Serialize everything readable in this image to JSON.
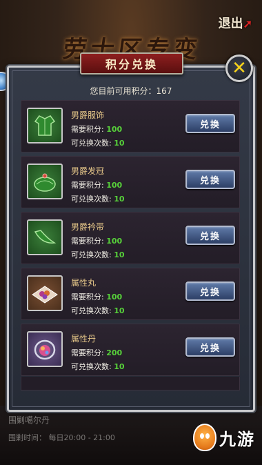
{
  "background": {
    "title": "劳士区专变",
    "exit_label": "退出",
    "bottom_event_name": "围剿噶尔丹",
    "bottom_event_time": "围剿时间：  每日20:00 - 21:00"
  },
  "watermark": {
    "text": "九游"
  },
  "dialog": {
    "title": "积分兑换",
    "points_label": "您目前可用积分：",
    "points_value": "167"
  },
  "items": [
    {
      "name": "男爵服饰",
      "required_label": "需要积分:",
      "required": "100",
      "count_label": "可兑换次数:",
      "count": "10",
      "button": "兑换",
      "icon": "robe-icon"
    },
    {
      "name": "男爵发冠",
      "required_label": "需要积分:",
      "required": "100",
      "count_label": "可兑换次数:",
      "count": "10",
      "button": "兑换",
      "icon": "hat-icon"
    },
    {
      "name": "男爵衿带",
      "required_label": "需要积分:",
      "required": "100",
      "count_label": "可兑换次数:",
      "count": "10",
      "button": "兑换",
      "icon": "sash-icon"
    },
    {
      "name": "属性丸",
      "required_label": "需要积分:",
      "required": "100",
      "count_label": "可兑换次数:",
      "count": "10",
      "button": "兑换",
      "icon": "pills-icon"
    },
    {
      "name": "属性丹",
      "required_label": "需要积分:",
      "required": "200",
      "count_label": "可兑换次数:",
      "count": "10",
      "button": "兑换",
      "icon": "elixir-icon"
    }
  ],
  "colors": {
    "accent_green": "#57d13a",
    "banner_red": "#8e1f1f",
    "close_yellow": "#f6d21a"
  }
}
